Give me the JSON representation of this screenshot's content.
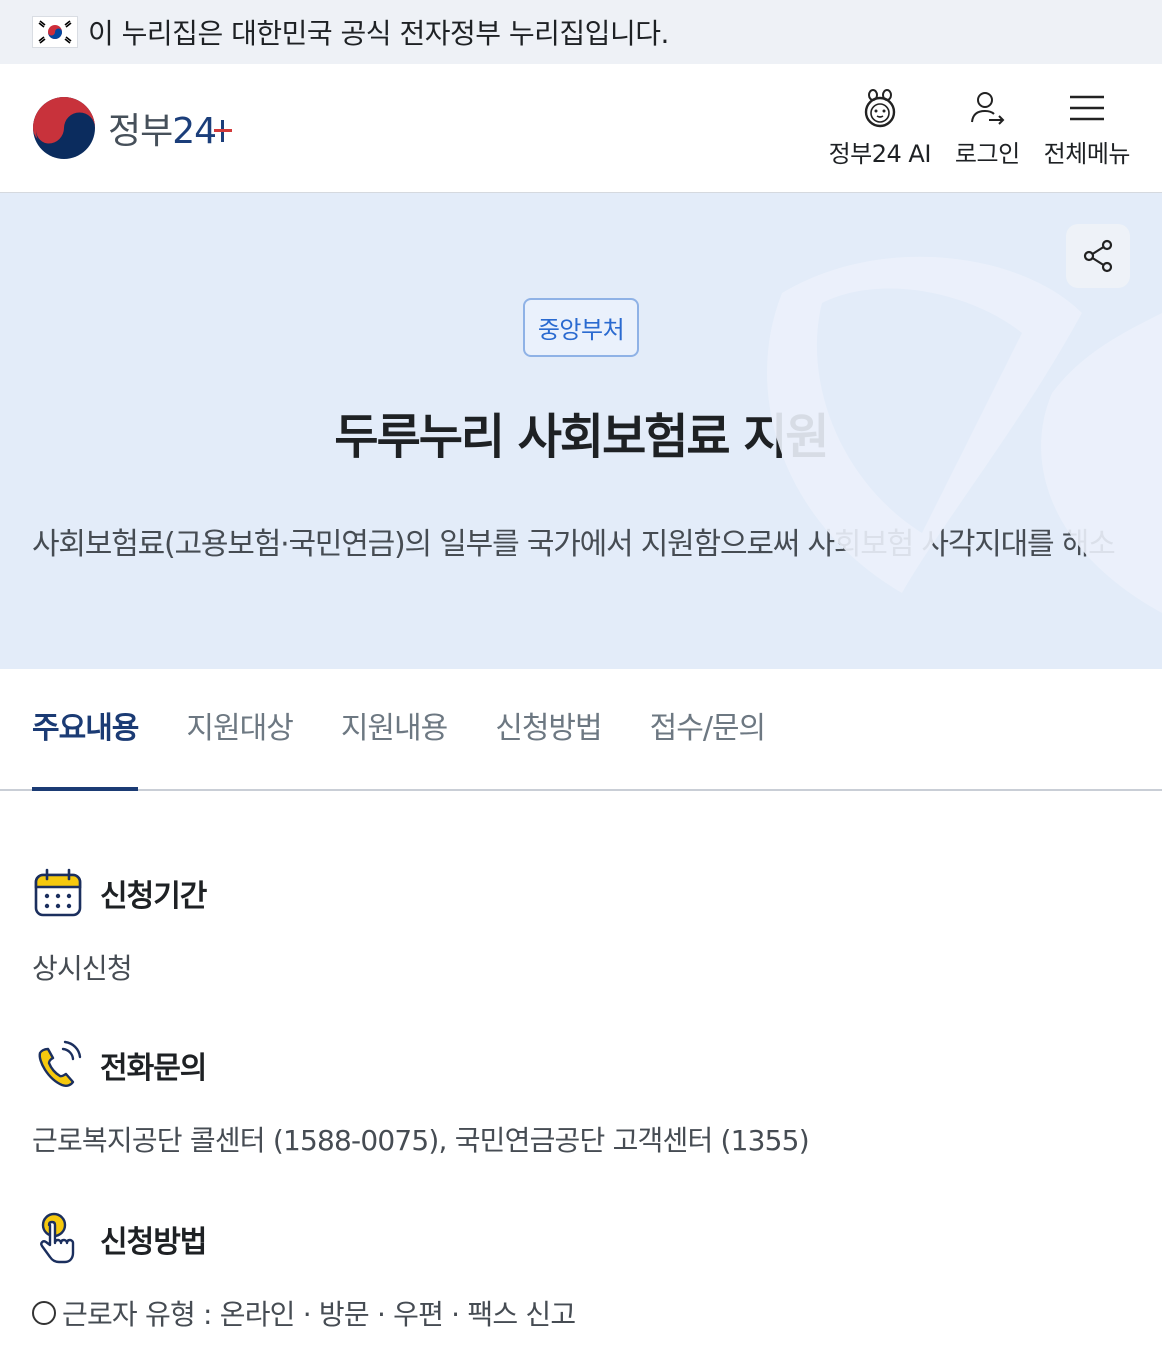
{
  "gov_banner": {
    "text": "이 누리집은 대한민국 공식 전자정부 누리집입니다."
  },
  "header": {
    "logo_text": "정부",
    "logo_num": "24",
    "actions": [
      {
        "label": "정부24 AI",
        "icon": "ai-character-icon"
      },
      {
        "label": "로그인",
        "icon": "login-user-icon"
      },
      {
        "label": "전체메뉴",
        "icon": "hamburger-menu-icon"
      }
    ]
  },
  "hero": {
    "badge": "중앙부처",
    "title": "두루누리 사회보험료 지원",
    "description": "사회보험료(고용보험·국민연금)의 일부를 국가에서 지원함으로써 사회보험 사각지대를 해소"
  },
  "tabs": [
    {
      "label": "주요내용",
      "active": true
    },
    {
      "label": "지원대상",
      "active": false
    },
    {
      "label": "지원내용",
      "active": false
    },
    {
      "label": "신청방법",
      "active": false
    },
    {
      "label": "접수/문의",
      "active": false
    }
  ],
  "sections": {
    "period": {
      "title": "신청기간",
      "body": "상시신청",
      "icon": "calendar-icon"
    },
    "phone": {
      "title": "전화문의",
      "body": "근로복지공단 콜센터 (1588-0075), 국민연금공단 고객센터 (1355)",
      "icon": "phone-icon"
    },
    "method": {
      "title": "신청방법",
      "line1": "근로자 유형 : 온라인 · 방문 · 우편 · 팩스 신고",
      "icon": "pointer-hand-icon"
    }
  },
  "colors": {
    "accent": "#1b3b74",
    "hero_bg": "#e3ecf9",
    "badge": "#2a6ad0",
    "icon_yellow": "#f6c90e"
  }
}
